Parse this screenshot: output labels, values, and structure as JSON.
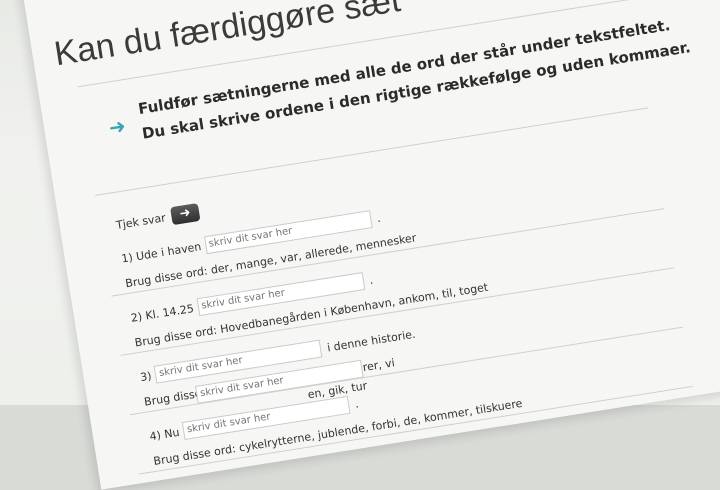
{
  "page": {
    "title": "Kan du færdiggøre sæt",
    "instructions": "Fuldfør sætningerne med alle de ord der står under tekstfeltet. Du skal skrive ordene i den rigtige rækkefølge og uden kommaer."
  },
  "check": {
    "label": "Tjek svar",
    "button_icon": "arrow-right-icon"
  },
  "questions": [
    {
      "prefix": "1) Ude i haven",
      "placeholder": "skriv dit svar her",
      "suffix": ".",
      "words": "Brug disse ord: der, mange, var, allerede, mennesker"
    },
    {
      "prefix": "2) Kl. 14.25",
      "placeholder": "skriv dit svar her",
      "suffix": ".",
      "words": "Brug disse ord: Hovedbanegården i København, ankom, til, toget"
    },
    {
      "prefix": "3)",
      "placeholder": "skriv dit svar her",
      "suffix": "i denne historie.",
      "words": "Brug disse ord: hundens, om, tanker, hører, vi"
    },
    {
      "prefix": "4) Nu",
      "placeholder": "skriv dit svar her",
      "suffix": ".",
      "words": "Brug disse ord: cykelrytterne, jublende, forbi, de, kommer, tilskuere"
    },
    {
      "prefix": "",
      "placeholder": "skriv dit svar her",
      "suffix": "",
      "words": "en, gik, tur"
    }
  ],
  "colors": {
    "accent": "#3aa6b3",
    "button_dark": "#2f2f2f"
  }
}
